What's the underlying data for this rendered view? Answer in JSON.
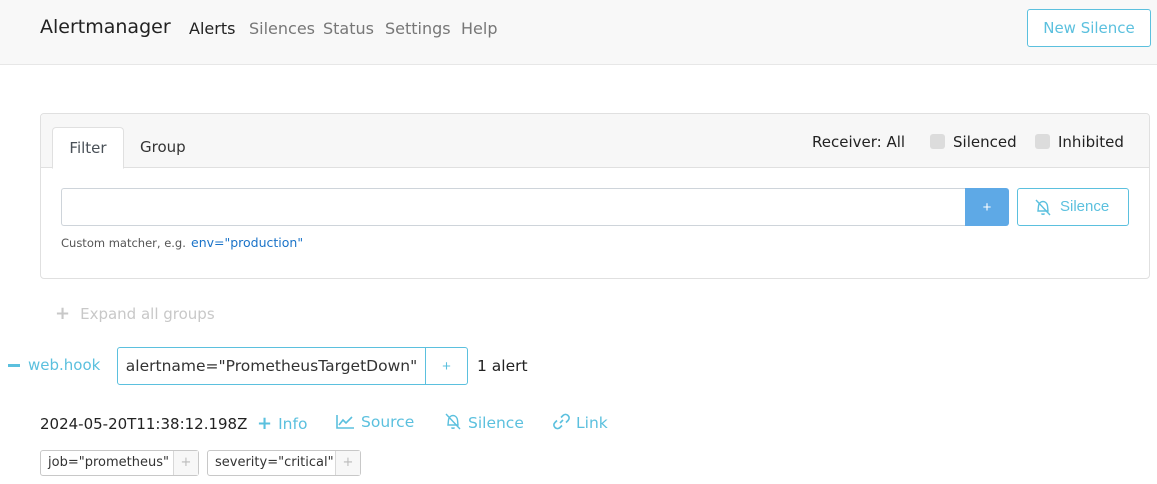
{
  "navbar": {
    "brand": "Alertmanager",
    "links": [
      "Alerts",
      "Silences",
      "Status",
      "Settings",
      "Help"
    ],
    "new_silence_label": "New Silence"
  },
  "filter_panel": {
    "tabs": [
      "Filter",
      "Group"
    ],
    "receiver_label": "Receiver: All",
    "silenced_label": "Silenced",
    "inhibited_label": "Inhibited",
    "input_value": "",
    "add_label": "+",
    "silence_label": "Silence",
    "hint_text": "Custom matcher, e.g.",
    "hint_example": "env=\"production\""
  },
  "expand_all_label": "Expand all groups",
  "groups": [
    {
      "receiver": "web.hook",
      "label": "alertname=\"PrometheusTargetDown\"",
      "add_label": "+",
      "alert_count": "1 alert",
      "alerts": [
        {
          "timestamp": "2024-05-20T11:38:12.198Z",
          "actions": {
            "info": "Info",
            "source": "Source",
            "silence": "Silence",
            "link": "Link"
          },
          "labels": [
            "job=\"prometheus\"",
            "severity=\"critical\""
          ],
          "label_add": "+"
        }
      ]
    }
  ],
  "colors": {
    "accent": "#5bc0de",
    "primary": "#5ea9e6",
    "link": "#1a73c8",
    "muted": "#c8c8c8"
  }
}
